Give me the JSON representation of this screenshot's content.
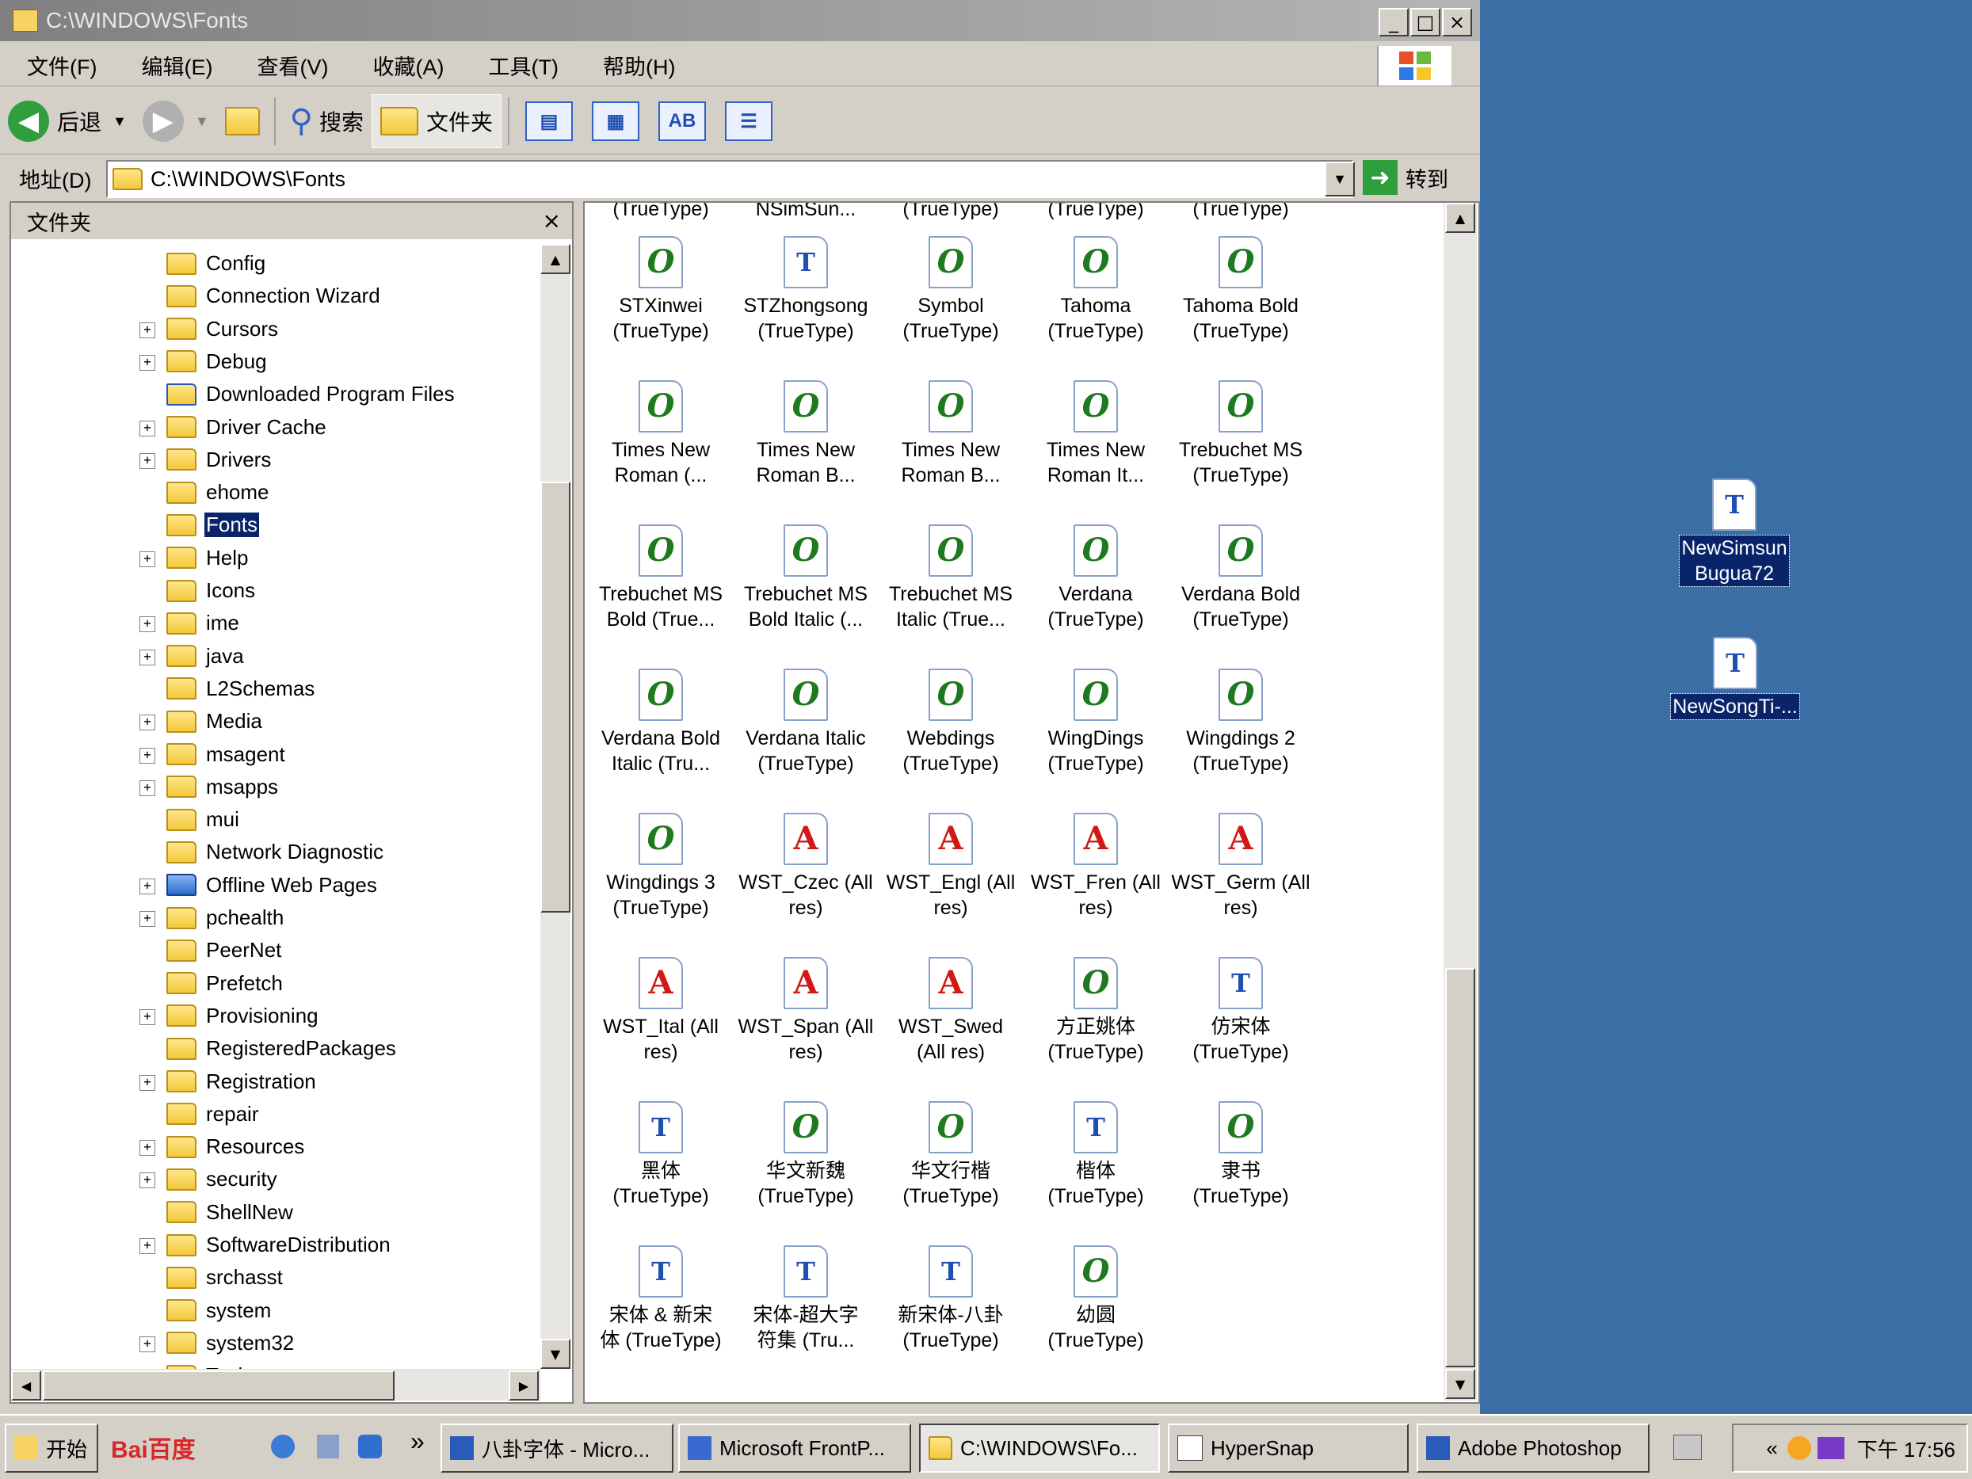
{
  "window": {
    "title": "C:\\WINDOWS\\Fonts",
    "min": "_",
    "max": "□",
    "close": "×"
  },
  "menu": [
    "文件(F)",
    "编辑(E)",
    "查看(V)",
    "收藏(A)",
    "工具(T)",
    "帮助(H)"
  ],
  "toolbar": {
    "back": "后退",
    "search": "搜索",
    "folders": "文件夹",
    "view_buttons": [
      "details",
      "icons",
      "AB",
      "list"
    ]
  },
  "address": {
    "label": "地址(D)",
    "value": "C:\\WINDOWS\\Fonts",
    "go": "转到"
  },
  "folder_pane": {
    "title": "文件夹",
    "close": "×",
    "items": [
      {
        "label": "Config",
        "exp": ""
      },
      {
        "label": "Connection Wizard",
        "exp": ""
      },
      {
        "label": "Cursors",
        "exp": "+"
      },
      {
        "label": "Debug",
        "exp": "+"
      },
      {
        "label": "Downloaded Program Files",
        "exp": "",
        "icon": "ie-folder"
      },
      {
        "label": "Driver Cache",
        "exp": "+"
      },
      {
        "label": "Drivers",
        "exp": "+"
      },
      {
        "label": "ehome",
        "exp": ""
      },
      {
        "label": "Fonts",
        "exp": "",
        "selected": true
      },
      {
        "label": "Help",
        "exp": "+"
      },
      {
        "label": "Icons",
        "exp": ""
      },
      {
        "label": "ime",
        "exp": "+"
      },
      {
        "label": "java",
        "exp": "+"
      },
      {
        "label": "L2Schemas",
        "exp": ""
      },
      {
        "label": "Media",
        "exp": "+"
      },
      {
        "label": "msagent",
        "exp": "+"
      },
      {
        "label": "msapps",
        "exp": "+"
      },
      {
        "label": "mui",
        "exp": ""
      },
      {
        "label": "Network Diagnostic",
        "exp": ""
      },
      {
        "label": "Offline Web Pages",
        "exp": "+",
        "icon": "web-folder"
      },
      {
        "label": "pchealth",
        "exp": "+"
      },
      {
        "label": "PeerNet",
        "exp": ""
      },
      {
        "label": "Prefetch",
        "exp": ""
      },
      {
        "label": "Provisioning",
        "exp": "+"
      },
      {
        "label": "RegisteredPackages",
        "exp": ""
      },
      {
        "label": "Registration",
        "exp": "+"
      },
      {
        "label": "repair",
        "exp": ""
      },
      {
        "label": "Resources",
        "exp": "+"
      },
      {
        "label": "security",
        "exp": "+"
      },
      {
        "label": "ShellNew",
        "exp": ""
      },
      {
        "label": "SoftwareDistribution",
        "exp": "+"
      },
      {
        "label": "srchasst",
        "exp": ""
      },
      {
        "label": "system",
        "exp": ""
      },
      {
        "label": "system32",
        "exp": "+"
      },
      {
        "label": "Tasks",
        "exp": ""
      }
    ]
  },
  "top_partial_labels": [
    "(TrueType)",
    "NSimSun...",
    "(TrueType)",
    "(TrueType)",
    "(TrueType)"
  ],
  "files": [
    {
      "name": "STXinwei\n(TrueType)",
      "type": "o"
    },
    {
      "name": "STZhongsong\n(TrueType)",
      "type": "tt"
    },
    {
      "name": "Symbol\n(TrueType)",
      "type": "o"
    },
    {
      "name": "Tahoma\n(TrueType)",
      "type": "o"
    },
    {
      "name": "Tahoma Bold\n(TrueType)",
      "type": "o"
    },
    {
      "name": "Times New\nRoman (...",
      "type": "o"
    },
    {
      "name": "Times New\nRoman B...",
      "type": "o"
    },
    {
      "name": "Times New\nRoman B...",
      "type": "o"
    },
    {
      "name": "Times New\nRoman It...",
      "type": "o"
    },
    {
      "name": "Trebuchet MS\n(TrueType)",
      "type": "o"
    },
    {
      "name": "Trebuchet MS\nBold (True...",
      "type": "o"
    },
    {
      "name": "Trebuchet MS\nBold Italic (...",
      "type": "o"
    },
    {
      "name": "Trebuchet MS\nItalic (True...",
      "type": "o"
    },
    {
      "name": "Verdana\n(TrueType)",
      "type": "o"
    },
    {
      "name": "Verdana Bold\n(TrueType)",
      "type": "o"
    },
    {
      "name": "Verdana Bold\nItalic (Tru...",
      "type": "o"
    },
    {
      "name": "Verdana Italic\n(TrueType)",
      "type": "o"
    },
    {
      "name": "Webdings\n(TrueType)",
      "type": "o"
    },
    {
      "name": "WingDings\n(TrueType)",
      "type": "o"
    },
    {
      "name": "Wingdings 2\n(TrueType)",
      "type": "o"
    },
    {
      "name": "Wingdings 3\n(TrueType)",
      "type": "o"
    },
    {
      "name": "WST_Czec (All\nres)",
      "type": "a"
    },
    {
      "name": "WST_Engl (All\nres)",
      "type": "a"
    },
    {
      "name": "WST_Fren (All\nres)",
      "type": "a"
    },
    {
      "name": "WST_Germ (All\nres)",
      "type": "a"
    },
    {
      "name": "WST_Ital (All\nres)",
      "type": "a"
    },
    {
      "name": "WST_Span (All\nres)",
      "type": "a"
    },
    {
      "name": "WST_Swed\n(All res)",
      "type": "a"
    },
    {
      "name": "方正姚体\n(TrueType)",
      "type": "o"
    },
    {
      "name": "仿宋体\n(TrueType)",
      "type": "tt"
    },
    {
      "name": "黑体\n(TrueType)",
      "type": "tt"
    },
    {
      "name": "华文新魏\n(TrueType)",
      "type": "o"
    },
    {
      "name": "华文行楷\n(TrueType)",
      "type": "o"
    },
    {
      "name": "楷体\n(TrueType)",
      "type": "tt"
    },
    {
      "name": "隶书\n(TrueType)",
      "type": "o"
    },
    {
      "name": "宋体 & 新宋\n体 (TrueType)",
      "type": "tt"
    },
    {
      "name": "宋体-超大字\n符集 (Tru...",
      "type": "tt"
    },
    {
      "name": "新宋体-八卦\n(TrueType)",
      "type": "tt"
    },
    {
      "name": "幼圆\n(TrueType)",
      "type": "o"
    }
  ],
  "desktop_icons": [
    {
      "name": "NewSimsun\nBugua72"
    },
    {
      "name": "NewSongTi-..."
    }
  ],
  "taskbar": {
    "start": "开始",
    "baidu": "Bai百度",
    "more": "»",
    "tasks": [
      "八卦字体 - Micro...",
      "Microsoft FrontP...",
      "C:\\WINDOWS\\Fo...",
      "HyperSnap",
      "Adobe Photoshop"
    ],
    "tray_expand": "«",
    "clock": "下午 17:56"
  },
  "colors": {
    "desktop": "#3a6ea5",
    "selection": "#0a246a",
    "chrome": "#d4d0c8"
  }
}
